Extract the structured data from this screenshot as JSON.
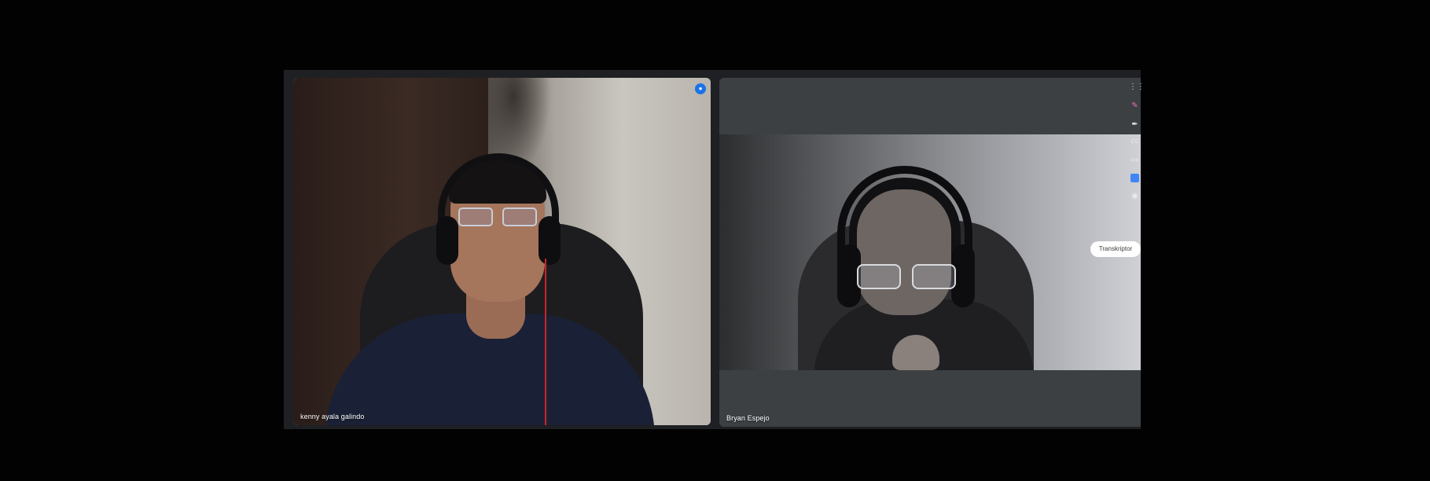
{
  "meeting": {
    "participants": [
      {
        "name": "kenny ayala galindo",
        "active_speaker": true
      },
      {
        "name": "Bryan Espejo",
        "active_speaker": false
      }
    ]
  },
  "overlay": {
    "transkriptor_label": "Transkriptor"
  },
  "toolbar": {
    "icons": [
      "apps-grid-icon",
      "draw-icon",
      "pen-icon",
      "closed-captions-icon",
      "language-icon",
      "document-icon",
      "camera-icon"
    ],
    "cc_label": "CC",
    "lang_label": "Engl"
  },
  "colors": {
    "active_border": "#8ab4f8",
    "tile_background": "#3c4043",
    "pin_button": "#1a73e8"
  }
}
